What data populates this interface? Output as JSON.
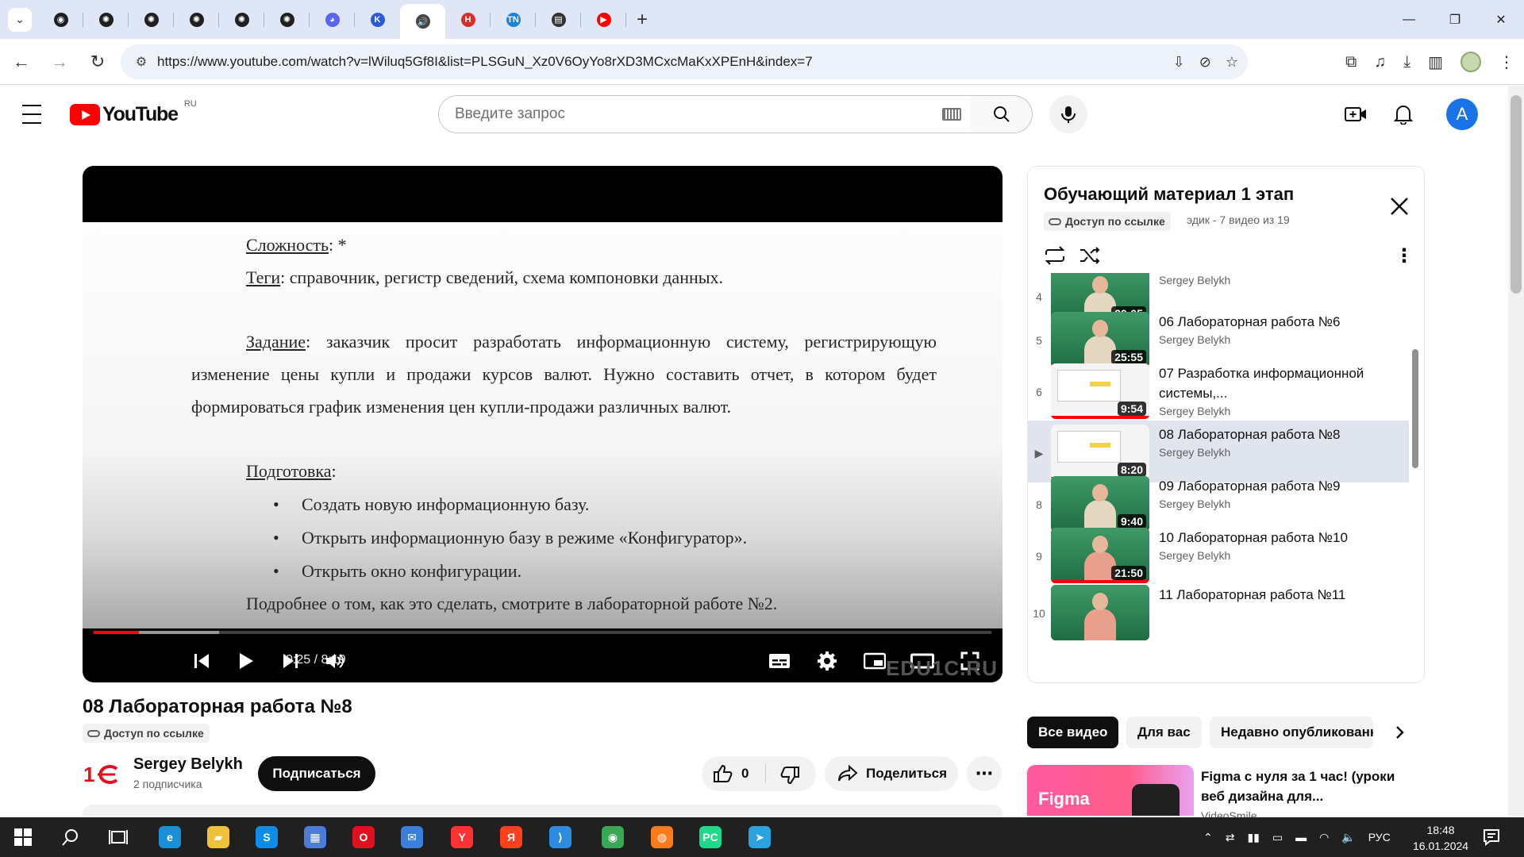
{
  "browser": {
    "tabs": [
      {
        "name": "github",
        "color": "#1b1f24",
        "glyph": "◉"
      },
      {
        "name": "openai-1",
        "color": "#202020",
        "glyph": "✺"
      },
      {
        "name": "openai-2",
        "color": "#202020",
        "glyph": "✺"
      },
      {
        "name": "openai-3",
        "color": "#202020",
        "glyph": "✺"
      },
      {
        "name": "openai-4",
        "color": "#202020",
        "glyph": "✺"
      },
      {
        "name": "openai-5",
        "color": "#202020",
        "glyph": "✺"
      },
      {
        "name": "discord",
        "color": "#5865f2",
        "glyph": "◕"
      },
      {
        "name": "k-app",
        "color": "#2a5bd7",
        "glyph": "K"
      },
      {
        "name": "audio",
        "color": "#444444",
        "glyph": "🔊"
      },
      {
        "name": "hh",
        "color": "#d92c2c",
        "glyph": "H"
      },
      {
        "name": "tn",
        "color": "#1b84d6",
        "glyph": "TN"
      },
      {
        "name": "monitor",
        "color": "#333333",
        "glyph": "▤"
      },
      {
        "name": "youtube",
        "color": "#ff0000",
        "glyph": "▶"
      }
    ],
    "url": "https://www.youtube.com/watch?v=lWiluq5Gf8I&list=PLSGuN_Xz0V6OyYo8rXD3MCxcMaKxXPEnH&index=7"
  },
  "youtube": {
    "region": "RU",
    "search_placeholder": "Введите запрос",
    "avatar_letter": "A",
    "brand_color": "#ff0000"
  },
  "player": {
    "slide": {
      "difficulty_label": "Сложность",
      "difficulty_value": ": *",
      "tags_label": "Теги",
      "tags_value": ": справочник, регистр сведений, схема компоновки данных.",
      "task_label": "Задание",
      "task_line1": ": заказчик просит разработать информационную систему, регистрирующую",
      "task_line2": "изменение цены купли и продажи курсов валют. Нужно составить отчет, в котором будет",
      "task_line3": "формироваться график изменения цен купли-продажи различных валют.",
      "prep_label": "Подготовка",
      "prep_colon": ":",
      "bullets": [
        "Создать новую информационную базу.",
        "Открыть информационную базу в режиме «Конфигуратор».",
        "Открыть окно конфигурации."
      ],
      "footer": "Подробнее о том, как это сделать, смотрите в лабораторной работе №2."
    },
    "time": "0:25 / 8:19",
    "played_fraction": 0.05,
    "loaded_fraction": 0.14,
    "watermark": "EDU1C.RU"
  },
  "video": {
    "title": "08 Лабораторная работа №8",
    "access_badge": "Доступ по ссылке",
    "channel": "Sergey Belykh",
    "subscribers": "2 подписчика",
    "subscribe_label": "Подписаться",
    "likes": "0",
    "share_label": "Поделиться",
    "more_label": "⋯"
  },
  "playlist": {
    "title": "Обучающий материал 1 этап",
    "access_badge": "Доступ по ссылке",
    "meta": "эдик - 7 видео из 19",
    "items": [
      {
        "index": "4",
        "title": "",
        "channel": "Sergey Belykh",
        "duration": "20:05",
        "thumb": "lecture",
        "watched": 1.0
      },
      {
        "index": "5",
        "title": "06 Лабораторная работа №6",
        "channel": "Sergey Belykh",
        "duration": "25:55",
        "thumb": "lecture",
        "watched": 1.0
      },
      {
        "index": "6",
        "title": "07 Разработка информационной системы,...",
        "channel": "Sergey Belykh",
        "duration": "9:54",
        "thumb": "screen",
        "watched": 1.0
      },
      {
        "index": "▶",
        "title": "08 Лабораторная работа №8",
        "channel": "Sergey Belykh",
        "duration": "8:20",
        "thumb": "screen",
        "watched": 0.05
      },
      {
        "index": "8",
        "title": "09 Лабораторная работа №9",
        "channel": "Sergey Belykh",
        "duration": "9:40",
        "thumb": "lecture",
        "watched": 1.0
      },
      {
        "index": "9",
        "title": "10 Лабораторная работа №10",
        "channel": "Sergey Belykh",
        "duration": "21:50",
        "thumb": "lecture2",
        "watched": 1.0
      },
      {
        "index": "10",
        "title": "11 Лабораторная работа №11",
        "channel": "",
        "duration": "",
        "thumb": "lecture2",
        "watched": 0
      }
    ]
  },
  "chips": [
    "Все видео",
    "Для вас",
    "Недавно опубликованн"
  ],
  "recommendation": {
    "thumb_text": "Figma",
    "title": "Figma с нуля за 1 час! (уроки веб дизайна для...",
    "channel": "VideoSmile"
  },
  "taskbar": {
    "language": "РУС",
    "time": "18:48",
    "date": "16.01.2024"
  }
}
